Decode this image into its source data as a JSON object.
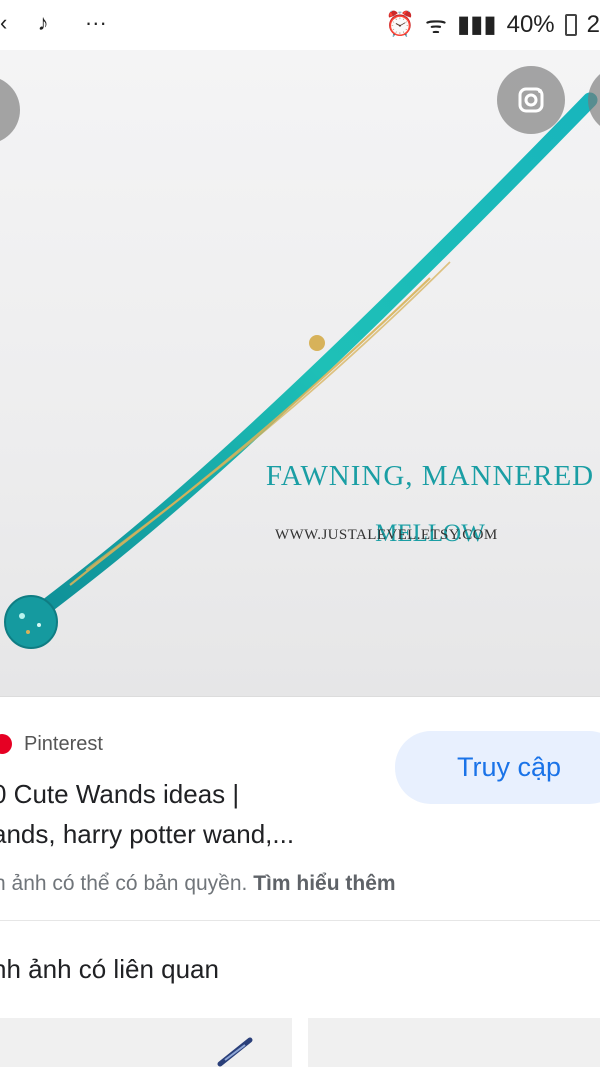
{
  "status_bar": {
    "left_items": [
      "‹",
      "♪",
      "···"
    ],
    "battery": "40%",
    "time_suffix": "2"
  },
  "hero": {
    "overlay_title": "FAWNING, MANNERED",
    "overlay_sub": "MELLOW",
    "overlay_url": "WWW.JUSTALEVEL.ETSY.COM",
    "wand_colors": [
      "#0f8f97",
      "#1ec0b7",
      "#d7b25a"
    ]
  },
  "result": {
    "source": "Pinterest",
    "title_line_1": "0 Cute Wands ideas |",
    "title_line_2": "ands, harry potter wand,...",
    "visit_label": "Truy cập",
    "copyright_text": "h ảnh có thể có bản quyền.",
    "learn_more": "Tìm hiểu thêm"
  },
  "related": {
    "title": "nh ảnh có liên quan"
  },
  "icons": {
    "lens": "lens-icon",
    "pinterest": "pinterest-icon"
  }
}
